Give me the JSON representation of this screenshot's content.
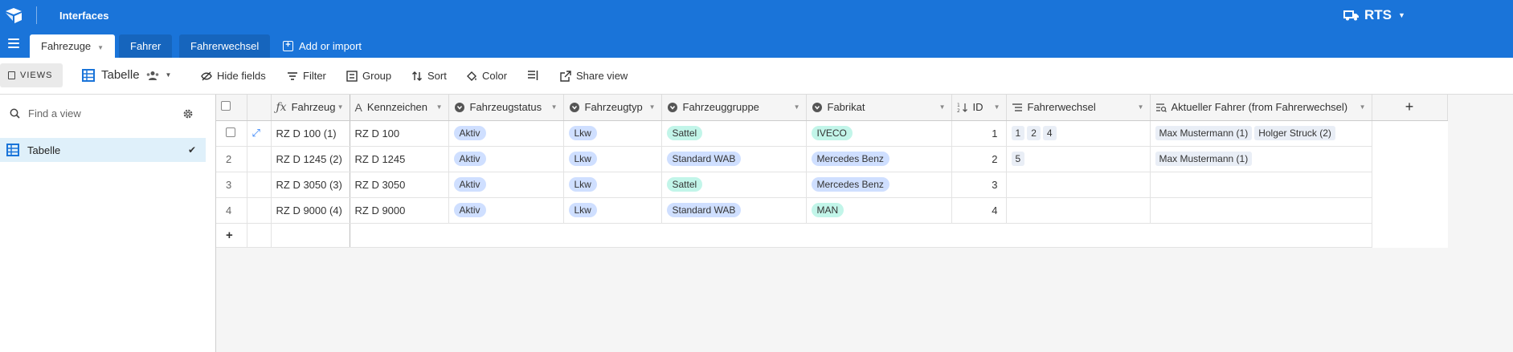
{
  "app": {
    "title": "Interfaces",
    "workspace": "RTS"
  },
  "tabs": [
    {
      "label": "Fahrezuge",
      "active": true
    },
    {
      "label": "Fahrer",
      "active": false
    },
    {
      "label": "Fahrerwechsel",
      "active": false
    }
  ],
  "add_import_label": "Add or import",
  "toolbar": {
    "views_label": "VIEWS",
    "view_name": "Tabelle",
    "hide_fields": "Hide fields",
    "filter": "Filter",
    "group": "Group",
    "sort": "Sort",
    "color": "Color",
    "share_view": "Share view"
  },
  "sidebar": {
    "search_placeholder": "Find a view",
    "views": [
      {
        "label": "Tabelle",
        "selected": true
      }
    ]
  },
  "columns": [
    {
      "label": "Fahrzeug",
      "icon": "formula-icon"
    },
    {
      "label": "Kennzeichen",
      "icon": "text-icon"
    },
    {
      "label": "Fahrzeugstatus",
      "icon": "single-select-icon"
    },
    {
      "label": "Fahrzeugtyp",
      "icon": "single-select-icon"
    },
    {
      "label": "Fahrzeuggruppe",
      "icon": "single-select-icon"
    },
    {
      "label": "Fabrikat",
      "icon": "single-select-icon"
    },
    {
      "label": "ID",
      "icon": "number-icon"
    },
    {
      "label": "Fahrerwechsel",
      "icon": "linked-record-icon"
    },
    {
      "label": "Aktueller Fahrer (from Fahrerwechsel)",
      "icon": "lookup-icon"
    }
  ],
  "rows": [
    {
      "no": "1",
      "fahrzeug": "RZ D 100 (1)",
      "kennzeichen": "RZ D 100",
      "status": "Aktiv",
      "typ": "Lkw",
      "gruppe": "Sattel",
      "fabrikat": "IVECO",
      "id": "1",
      "wechsel": [
        "1",
        "2",
        "4"
      ],
      "fahrer": [
        "Max Mustermann (1)",
        "Holger Struck (2)"
      ]
    },
    {
      "no": "2",
      "fahrzeug": "RZ D 1245 (2)",
      "kennzeichen": "RZ D 1245",
      "status": "Aktiv",
      "typ": "Lkw",
      "gruppe": "Standard WAB",
      "fabrikat": "Mercedes Benz",
      "id": "2",
      "wechsel": [
        "5"
      ],
      "fahrer": [
        "Max Mustermann (1)"
      ]
    },
    {
      "no": "3",
      "fahrzeug": "RZ D 3050 (3)",
      "kennzeichen": "RZ D 3050",
      "status": "Aktiv",
      "typ": "Lkw",
      "gruppe": "Sattel",
      "fabrikat": "Mercedes Benz",
      "id": "3",
      "wechsel": [],
      "fahrer": []
    },
    {
      "no": "4",
      "fahrzeug": "RZ D 9000 (4)",
      "kennzeichen": "RZ D 9000",
      "status": "Aktiv",
      "typ": "Lkw",
      "gruppe": "Standard WAB",
      "fabrikat": "MAN",
      "id": "4",
      "wechsel": [],
      "fahrer": []
    }
  ],
  "colors": {
    "header_blue": "#1a74d9",
    "chip_blue": "#cfdfff",
    "chip_teal": "#c2f5e9",
    "chip_gray": "#e9eef6",
    "selected_view": "#dff0fa"
  },
  "chip_colors": {
    "Aktiv": "#cfdfff",
    "Lkw": "#cfdfff",
    "Sattel": "#c2f5e9",
    "Standard WAB": "#cfdfff",
    "IVECO": "#c2f5e9",
    "Mercedes Benz": "#cfdfff",
    "MAN": "#c2f5e9"
  }
}
